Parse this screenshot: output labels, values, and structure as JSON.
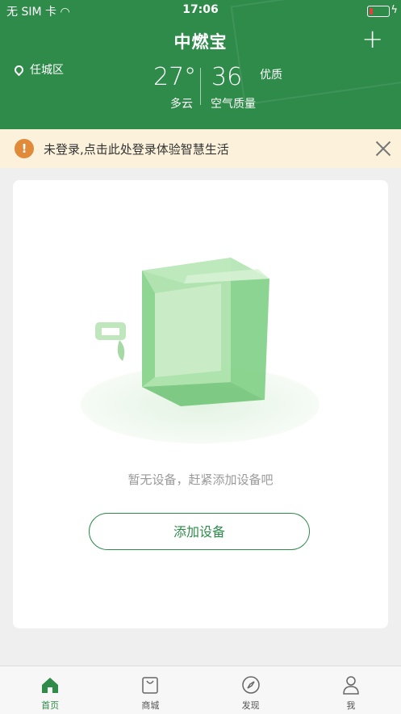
{
  "status_bar": {
    "carrier": "无 SIM 卡",
    "time": "17:06"
  },
  "header": {
    "title": "中燃宝",
    "location": "任城区",
    "temperature": "27°",
    "weather": "多云",
    "aqi_value": "36",
    "aqi_level": "优质",
    "aqi_label": "空气质量"
  },
  "notice": {
    "text": "未登录,点击此处登录体验智慧生活",
    "warn_symbol": "!"
  },
  "empty_state": {
    "text": "暂无设备，赶紧添加设备吧",
    "button_label": "添加设备"
  },
  "tabbar": [
    {
      "label": "首页",
      "icon": "home-icon",
      "active": true
    },
    {
      "label": "商城",
      "icon": "shopping-bag-icon",
      "active": false
    },
    {
      "label": "发现",
      "icon": "compass-icon",
      "active": false
    },
    {
      "label": "我",
      "icon": "user-icon",
      "active": false
    }
  ],
  "colors": {
    "brand_green": "#2f8b4a",
    "notice_bg": "#fcf2dc",
    "warn_orange": "#e08a3a"
  }
}
